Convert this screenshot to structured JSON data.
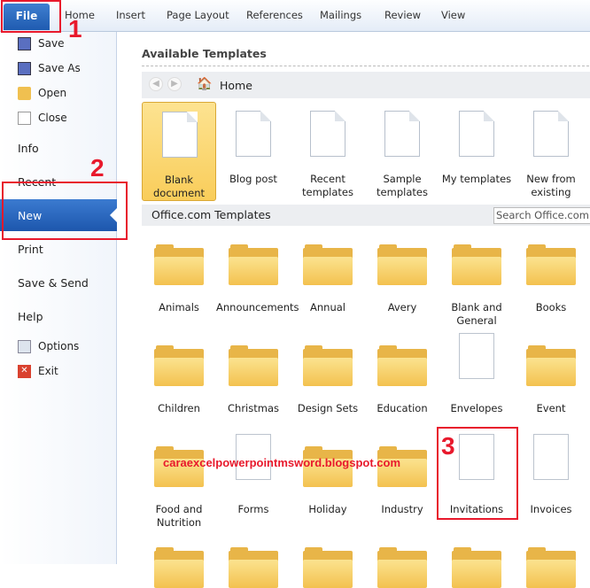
{
  "ribbon": {
    "file": "File",
    "tabs": [
      "Home",
      "Insert",
      "Page Layout",
      "References",
      "Mailings",
      "Review",
      "View"
    ]
  },
  "sidebar": {
    "items": [
      {
        "label": "Save",
        "icon": "save-icon"
      },
      {
        "label": "Save As",
        "icon": "save-as-icon"
      },
      {
        "label": "Open",
        "icon": "open-folder-icon"
      },
      {
        "label": "Close",
        "icon": "close-icon"
      },
      {
        "label": "Info"
      },
      {
        "label": "Recent"
      },
      {
        "label": "New",
        "selected": true
      },
      {
        "label": "Print"
      },
      {
        "label": "Save & Send"
      },
      {
        "label": "Help"
      },
      {
        "label": "Options",
        "icon": "options-icon"
      },
      {
        "label": "Exit",
        "icon": "exit-icon"
      }
    ]
  },
  "main": {
    "title": "Available Templates",
    "nav": {
      "location": "Home"
    },
    "templates": [
      "Blank document",
      "Blog post",
      "Recent templates",
      "Sample templates",
      "My templates",
      "New from existing"
    ],
    "office": {
      "title": "Office.com Templates",
      "search_placeholder": "Search Office.com for templates"
    },
    "categories": [
      "Animals",
      "Announcements",
      "Annual",
      "Avery",
      "Blank and General",
      "Books",
      "Children",
      "Christmas",
      "Design Sets",
      "Education",
      "Envelopes",
      "Event",
      "Food and Nutrition",
      "Forms",
      "Holiday",
      "Industry",
      "Invitations",
      "Invoices"
    ]
  },
  "annotations": {
    "n1": "1",
    "n2": "2",
    "n3": "3",
    "watermark": "caraexcelpowerpointmsword.blogspot.com"
  },
  "colors": {
    "accent": "#1f5bb0",
    "annotation": "#e8192c",
    "folder": "#f3c14f",
    "selected_template": "#f9cd5a"
  }
}
